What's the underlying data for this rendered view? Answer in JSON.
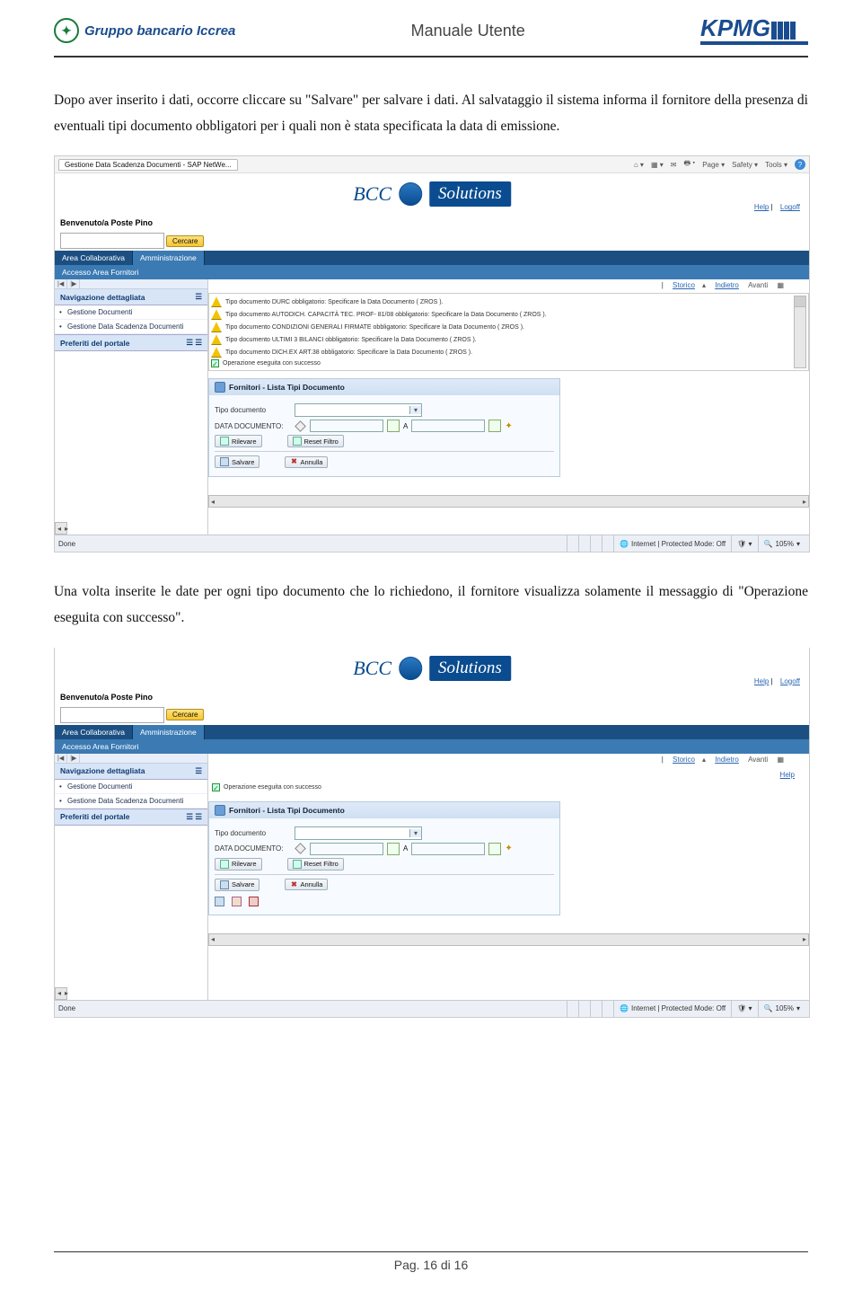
{
  "header": {
    "logo_left_text": "Gruppo bancario Iccrea",
    "title": "Manuale Utente",
    "logo_right_text": "KPMG"
  },
  "paragraphs": {
    "p1": "Dopo aver inserito i dati, occorre cliccare su \"Salvare\" per salvare i dati. Al salvataggio il sistema informa il fornitore della presenza di eventuali tipi documento obbligatori per i quali non è stata specificata la data di emissione.",
    "p2": "Una volta inserite le date per ogni tipo documento che lo richiedono, il fornitore visualizza solamente il messaggio di \"Operazione eseguita con successo\"."
  },
  "shot": {
    "tabname": "Gestione Data Scadenza Documenti - SAP NetWe...",
    "toolbar": {
      "page": "Page",
      "safety": "Safety",
      "tools": "Tools"
    },
    "logo_bcc": "BCC",
    "logo_sol": "Solutions",
    "link_help": "Help",
    "link_logoff": "Logoff",
    "welcome": "Benvenuto/a Poste Pino",
    "search_label": "Cercare",
    "tab1": "Area Collaborativa",
    "tab2": "Amministrazione",
    "subnav": "Accesso Area Fornitori",
    "sidebar": {
      "head1": "Navigazione dettagliata",
      "item1": "Gestione Documenti",
      "item2": "Gestione Data Scadenza Documenti",
      "head2": "Preferiti del portale"
    },
    "toplinks": {
      "storico": "Storico",
      "indietro": "Indietro",
      "avanti": "Avanti"
    },
    "help_only": "Help",
    "warnings": [
      "Tipo documento DURC obbligatorio: Specificare la Data Documento ( ZROS ).",
      "Tipo documento AUTODICH. CAPACITÀ TEC. PROF- 81/08 obbligatorio: Specificare la Data Documento ( ZROS ).",
      "Tipo documento CONDIZIONI GENERALI FIRMATE obbligatorio: Specificare la Data Documento ( ZROS ).",
      "Tipo documento ULTIMI 3 BILANCI obbligatorio: Specificare la Data Documento ( ZROS ).",
      "Tipo documento DICH.EX ART.38 obbligatorio: Specificare la Data Documento ( ZROS )."
    ],
    "success": "Operazione eseguita con successo",
    "panel": {
      "title": "Fornitori - Lista Tipi Documento",
      "row_tipo": "Tipo documento",
      "row_data": "DATA DOCUMENTO:",
      "lbl_a": "A",
      "btn_rilevare": "Rilevare",
      "btn_reset": "Reset Filtro",
      "btn_salvare": "Salvare",
      "btn_annulla": "Annulla"
    },
    "status": {
      "done": "Done",
      "mode": "Internet | Protected Mode: Off",
      "zoom": "105%"
    }
  },
  "footer": {
    "pagenum": "Pag. 16 di 16"
  }
}
